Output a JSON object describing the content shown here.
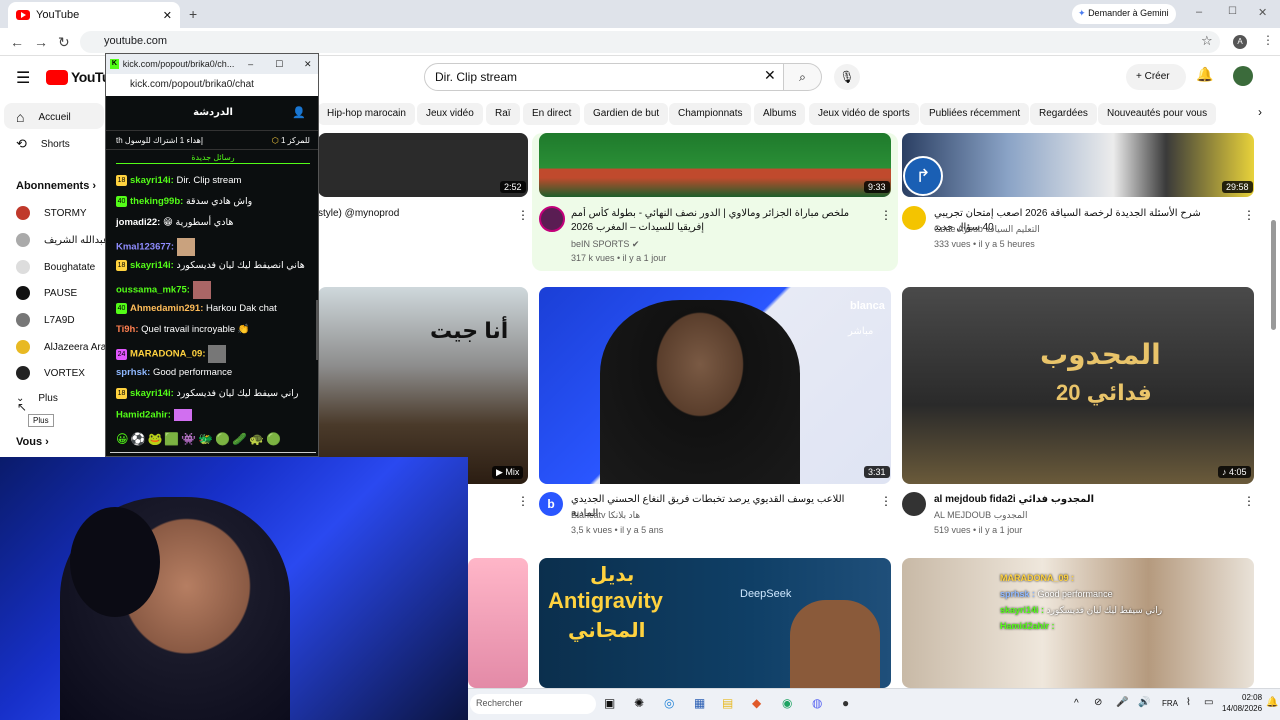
{
  "browser": {
    "tab_title": "YouTube",
    "url": "youtube.com",
    "gemini_button": "Demander à Gemini"
  },
  "youtube": {
    "search_value": "Dir. Clip stream",
    "create_label": "Créer",
    "chips": [
      "Hip-hop marocain",
      "Jeux vidéo",
      "Raï",
      "En direct",
      "Gardien de but",
      "Championnats",
      "Albums",
      "Jeux vidéo de sports",
      "Publiées récemment",
      "Regardées",
      "Nouveautés pour vous"
    ],
    "sidebar": {
      "home": "Accueil",
      "shorts": "Shorts",
      "subs_heading": "Abonnements",
      "subs": [
        "STORMY",
        "عبدالله الشريف Ab",
        "Boughatate",
        "PAUSE",
        "L7A9D",
        "AlJazeera Ara",
        "VORTEX"
      ],
      "more": "Plus",
      "tooltip": "Plus",
      "you": "Vous"
    },
    "videos": [
      {
        "duration": "2:52",
        "title": "style) @mynoprod",
        "channel": "",
        "meta": ""
      },
      {
        "duration": "9:33",
        "title": "ملخص مباراة الجزائر ومالاوي | الدور نصف النهائي - بطولة كأس أمم إفريقيا للسيدات – المغرب 2026",
        "channel": "beIN SPORTS",
        "meta": "317 k vues • il y a 1 jour"
      },
      {
        "duration": "29:58",
        "title": "شرح الأسئلة الجديدة لرخصة السياقة 2026 اصعب إمتحان تجريبي 40 سؤال جديد",
        "channel": "Code Ayoub التعليم السياقة",
        "meta": "333 vues • il y a 5 heures"
      },
      {
        "duration": "Mix",
        "title": "",
        "channel": "",
        "meta": ""
      },
      {
        "duration": "3:31",
        "title": "اللاعب يوسف القديوي يرصد تخبطات فريق النغاع الحسني الجديدي المادية",
        "channel": "Blancatv هاد بلانكا",
        "meta": "3,5 k vues • il y a 5 ans"
      },
      {
        "duration": "4:05",
        "title": "al mejdoub fida2i المجدوب فدائي",
        "channel": "AL MEJDOUB المجدوب",
        "meta": "519 vues • il y a 1 jour"
      }
    ],
    "thumb_texts": {
      "v4": "أنا جيت",
      "v5_brand": "blanca",
      "v5_live": "مباشر",
      "v6_title": "المجدوب",
      "v6_sub": "فدائي 20",
      "v8_top": "بديل",
      "v8_main": "Antigravity",
      "v8_bottom": "المجاني",
      "v8_logo": "DeepSeek"
    },
    "overlay_chat": [
      {
        "user": "MARADONA_09 :",
        "text": ""
      },
      {
        "user": "sprhsk :",
        "text": "Good performance"
      },
      {
        "user": "skayri14i :",
        "text": "راني سيفط ليك ليان فديسكورد"
      },
      {
        "user": "Hamid2ahir :",
        "text": ""
      }
    ]
  },
  "chat": {
    "window_title": "kick.com/popout/brika0/ch...",
    "url": "kick.com/popout/brika0/chat",
    "header": "الدردشة",
    "leader_left": "للمركز 1",
    "leader_right": "th إهداء 1 اشتراك للوسول",
    "new_messages": "رسائل جديدة",
    "messages": [
      {
        "badge": "18",
        "user": "skayri14i:",
        "text": "Dir. Clip stream",
        "color": "#53fc18"
      },
      {
        "badge": "40",
        "user": "theking99b:",
        "text": "واش هادي سدقة",
        "color": "#53fc18"
      },
      {
        "badge": "",
        "user": "jomadi22:",
        "text": "هادي أسطورية",
        "color": "#fff"
      },
      {
        "badge": "",
        "user": "Kmal123677:",
        "text": "",
        "color": "#8f8cff"
      },
      {
        "badge": "18",
        "user": "skayri14i:",
        "text": "هاني انصيفط ليك ليان فديسكورد",
        "color": "#53fc18"
      },
      {
        "badge": "",
        "user": "oussama_mk75:",
        "text": "",
        "color": "#53fc18"
      },
      {
        "badge": "40",
        "user": "Ahmedamin291:",
        "text": "Harkou Dak chat",
        "color": "#ffbd59"
      },
      {
        "badge": "",
        "user": "Ti9h:",
        "text": "Quel travail incroyable",
        "color": "#ff7f50"
      },
      {
        "badge": "24",
        "user": "MARADONA_09:",
        "text": "",
        "color": "#ffd23f"
      },
      {
        "badge": "",
        "user": "sprhsk:",
        "text": "Good performance",
        "color": "#8fb8ff"
      },
      {
        "badge": "18",
        "user": "skayri14i:",
        "text": "راني سيفط ليك ليان فديسكورد",
        "color": "#53fc18"
      },
      {
        "badge": "",
        "user": "Hamid2ahir:",
        "text": "",
        "color": "#53fc18"
      }
    ]
  },
  "taskbar": {
    "search_placeholder": "Rechercher",
    "lang": "FRA",
    "time": "02:08",
    "date": "14/08/2026"
  },
  "colors": {
    "yt_red": "#ff0000",
    "kick_green": "#53fc18",
    "chip_bg": "#f2f2f2"
  }
}
